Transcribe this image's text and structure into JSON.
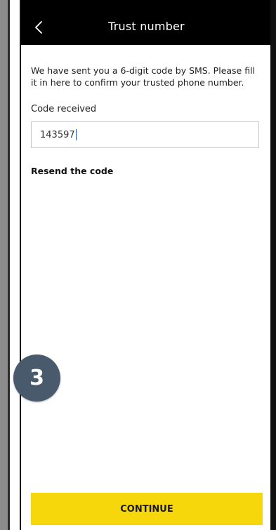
{
  "header": {
    "title": "Trust number",
    "back_icon": "chevron-left-icon"
  },
  "content": {
    "instruction": "We have sent you a 6-digit code by SMS. Please fill it in here to confirm your trusted phone number.",
    "code_label": "Code received",
    "code_value": "143597",
    "resend_label": "Resend the code"
  },
  "step_badge": "3",
  "footer": {
    "continue_label": "CONTINUE"
  },
  "colors": {
    "header_bg": "#000000",
    "button_bg": "#f5d70c",
    "badge_bg": "#4a5a6d",
    "caret": "#1f4fd6"
  }
}
